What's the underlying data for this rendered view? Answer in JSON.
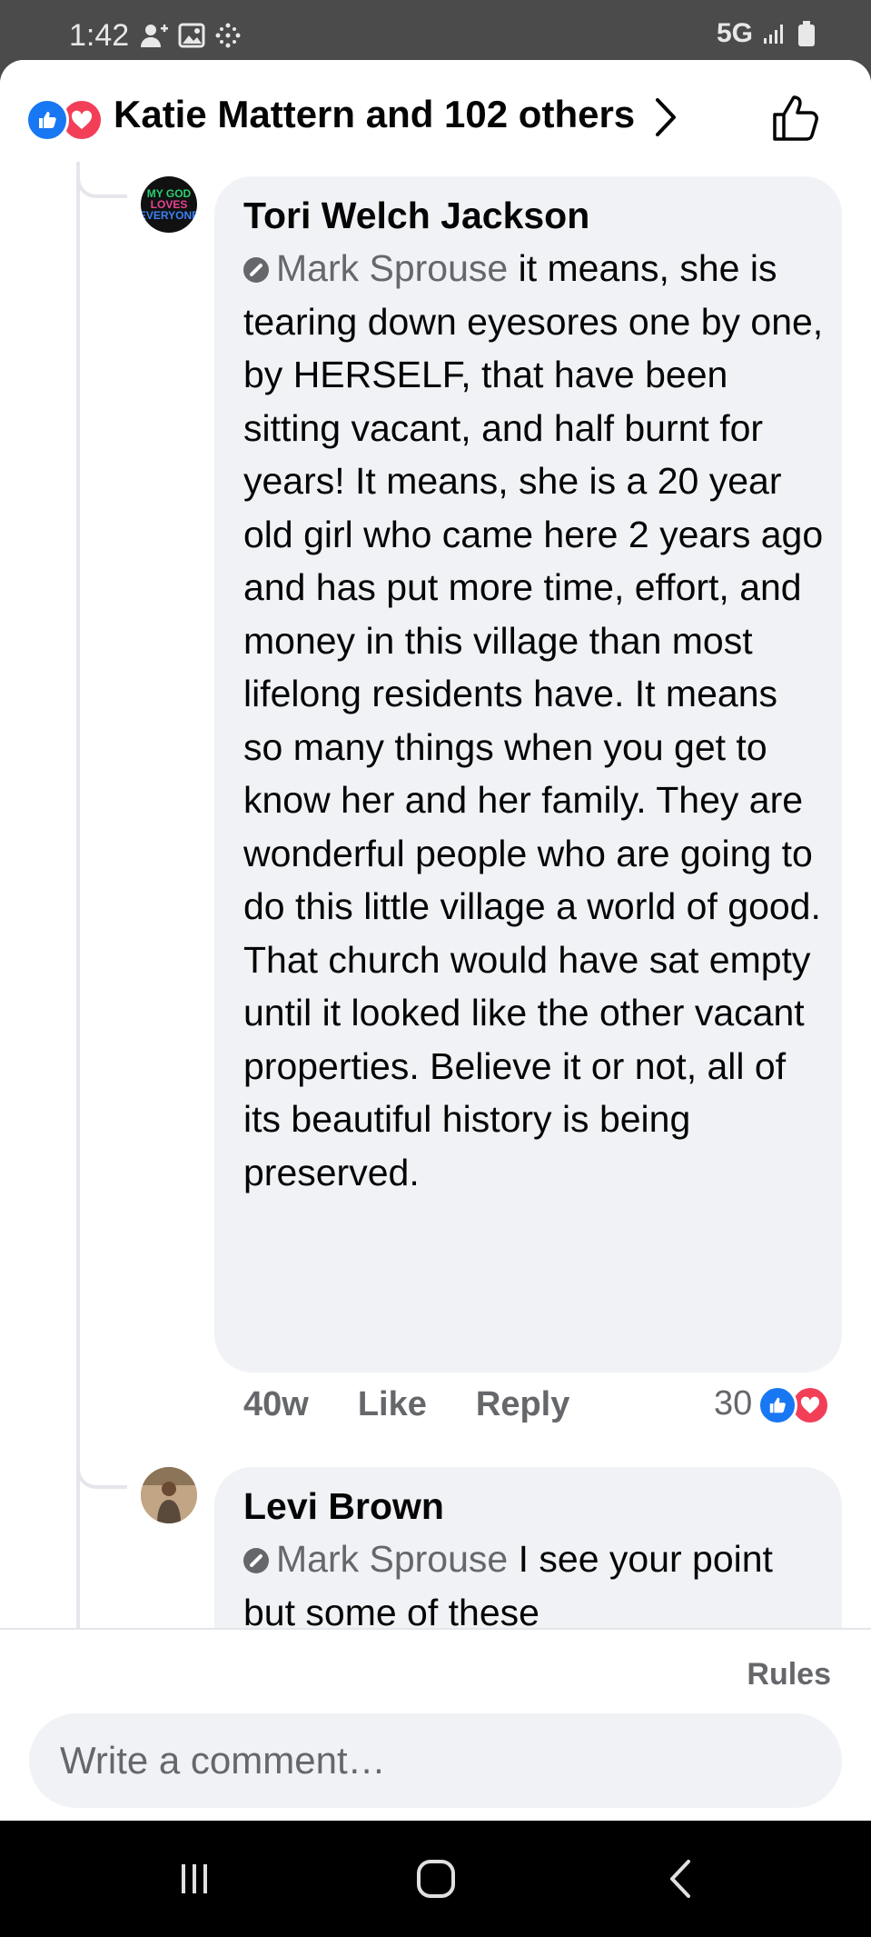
{
  "status_bar": {
    "time": "1:42",
    "network": "5G",
    "icons": [
      "person-add-icon",
      "image-icon",
      "dots-grid-icon",
      "signal-icon",
      "battery-icon"
    ]
  },
  "header": {
    "reactions": [
      "like",
      "love"
    ],
    "title": "Katie Mattern and 102 others",
    "chevron_icon": "chevron-right-icon",
    "action_icon": "thumbs-up-icon"
  },
  "comments": [
    {
      "author": "Tori Welch Jackson",
      "avatar_text": [
        "MY GOD",
        "LOVES",
        "EVERYONE"
      ],
      "mention": "Mark Sprouse",
      "text": " it means, she is tearing down eyesores one by one, by HERSELF, that have been sitting vacant, and half burnt for years! It means, she is a 20 year old girl who came here 2 years ago and has put more time, effort, and money in this village than most lifelong residents have. It means so many things when you get to know her and her family. They are wonderful people who are going to do this little village a world of good. That church would have sat empty until it looked like the other vacant properties. Believe it or not, all of its beautiful history is being preserved.",
      "age": "40w",
      "like_label": "Like",
      "reply_label": "Reply",
      "reaction_count": "30",
      "reactions": [
        "like",
        "love"
      ]
    },
    {
      "author": "Levi Brown",
      "mention": "Mark Sprouse",
      "text": " I see your point but some of these"
    }
  ],
  "composer": {
    "rules_label": "Rules",
    "placeholder": "Write a comment…"
  },
  "nav_bar": {
    "buttons": [
      "recent-apps-icon",
      "home-icon",
      "back-icon"
    ]
  },
  "colors": {
    "like_blue": "#1877f2",
    "love_red": "#f33e58",
    "bubble_bg": "#f0f2f5",
    "secondary_text": "#65676b"
  }
}
